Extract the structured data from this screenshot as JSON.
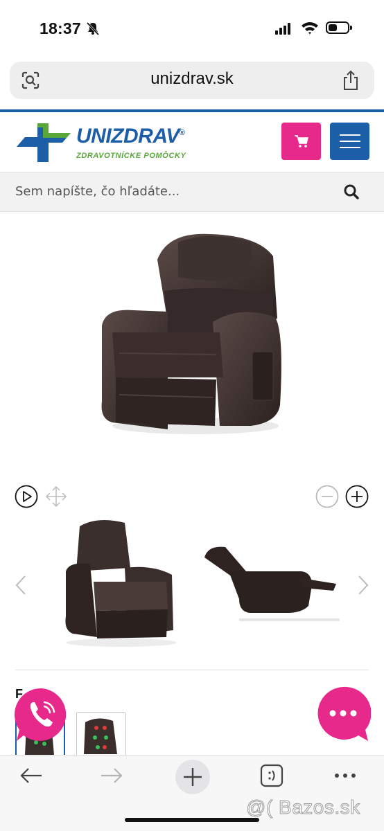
{
  "status_bar": {
    "time": "18:37"
  },
  "browser": {
    "url": "unizdrav.sk"
  },
  "site": {
    "logo_name": "UNIZDRAV",
    "logo_registered": "®",
    "logo_tagline": "ZDRAVOTNÍCKE POMÔCKY",
    "search_placeholder": "Sem napíšte, čo hľadáte..."
  },
  "product": {
    "section_label": "F"
  },
  "colors": {
    "brand_blue": "#1c5ea8",
    "brand_green": "#5aa83a",
    "accent_pink": "#e6298a"
  },
  "watermark": "@( Bazos.sk"
}
